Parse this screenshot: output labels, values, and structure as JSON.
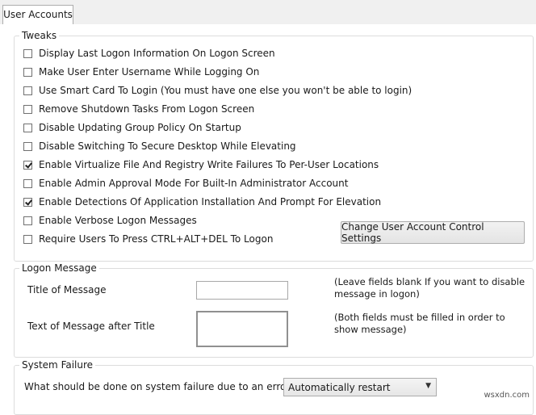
{
  "tab": {
    "label": "User Accounts"
  },
  "tweaks": {
    "title": "Tweaks",
    "items": [
      {
        "label": "Display Last Logon Information On Logon Screen",
        "checked": false
      },
      {
        "label": "Make User Enter Username While Logging On",
        "checked": false
      },
      {
        "label": "Use Smart Card To Login (You must have one else you won't be able to login)",
        "checked": false
      },
      {
        "label": "Remove Shutdown Tasks From Logon Screen",
        "checked": false
      },
      {
        "label": "Disable Updating Group Policy On Startup",
        "checked": false
      },
      {
        "label": "Disable Switching To Secure Desktop While Elevating",
        "checked": false
      },
      {
        "label": "Enable Virtualize File And Registry Write Failures To Per-User Locations",
        "checked": true
      },
      {
        "label": "Enable Admin Approval Mode For Built-In Administrator Account",
        "checked": false
      },
      {
        "label": "Enable Detections Of Application Installation And Prompt For Elevation",
        "checked": true
      },
      {
        "label": "Enable Verbose Logon Messages",
        "checked": false
      },
      {
        "label": "Require Users To Press CTRL+ALT+DEL To Logon",
        "checked": false
      }
    ],
    "uac_button": "Change User Account Control Settings"
  },
  "logon_message": {
    "title": "Logon Message",
    "title_label": "Title of Message",
    "title_value": "",
    "text_label": "Text of Message after Title",
    "text_value": "",
    "note1": "(Leave fields blank If you want to disable message in logon)",
    "note2": "(Both fields must be filled in order to show message)"
  },
  "system_failure": {
    "title": "System Failure",
    "question": "What should be done on system failure due to an error:",
    "selected": "Automatically restart"
  },
  "watermark": "wsxdn.com"
}
